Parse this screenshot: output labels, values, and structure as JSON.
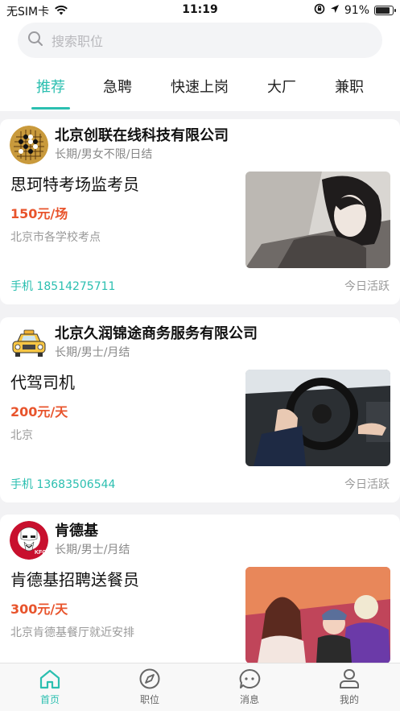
{
  "status_bar": {
    "carrier": "无SIM卡",
    "time": "11:19",
    "battery": "91%",
    "battery_level": 0.91
  },
  "search": {
    "placeholder": "搜索职位"
  },
  "tabs": [
    {
      "label": "推荐",
      "active": true
    },
    {
      "label": "急聘"
    },
    {
      "label": "快速上岗"
    },
    {
      "label": "大厂"
    },
    {
      "label": "兼职"
    }
  ],
  "jobs": [
    {
      "company": "北京创联在线科技有限公司",
      "terms": "长期/男女不限/日结",
      "title": "思珂特考场监考员",
      "salary": "150元/场",
      "location": "北京市各学校考点",
      "phone": "手机 18514275711",
      "activity": "今日活跃"
    },
    {
      "company": "北京久润锦途商务服务有限公司",
      "terms": "长期/男士/月结",
      "title": "代驾司机",
      "salary": "200元/天",
      "location": "北京",
      "phone": "手机 13683506544",
      "activity": "今日活跃"
    },
    {
      "company": "肯德基",
      "logo_text": "KFC",
      "terms": "长期/男士/月结",
      "title": "肯德基招聘送餐员",
      "salary": "300元/天",
      "location": "北京肯德基餐厅就近安排"
    }
  ],
  "tabbar": [
    {
      "label": "首页",
      "icon": "home-icon",
      "active": true
    },
    {
      "label": "职位",
      "icon": "compass-icon"
    },
    {
      "label": "消息",
      "icon": "message-icon"
    },
    {
      "label": "我的",
      "icon": "profile-icon"
    }
  ],
  "colors": {
    "accent": "#2bbfb0",
    "salary": "#e8542c",
    "background": "#f2f2f4"
  }
}
